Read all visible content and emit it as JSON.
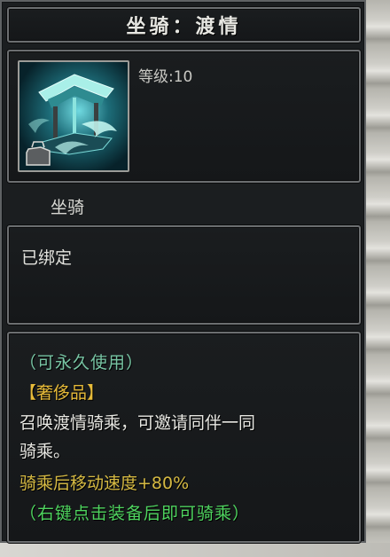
{
  "tooltip": {
    "title": "坐骑：渡情",
    "level_text": "等级:10",
    "icon": "pavilion-mount-icon",
    "item_type": "坐骑",
    "bind_status": "已绑定",
    "description": {
      "usage": "（可永久使用）",
      "quality": "【奢侈品】",
      "summary_line1": "召唤渡情骑乘，可邀请同伴一同",
      "summary_line2": "骑乘。",
      "effect": "骑乘后移动速度+80%",
      "hint": "（右键点击装备后即可骑乘）"
    }
  },
  "colors": {
    "usage": "#78c5a4",
    "quality": "#e7bb3a",
    "effect": "#d6ba43",
    "hint": "#4fd45f"
  }
}
